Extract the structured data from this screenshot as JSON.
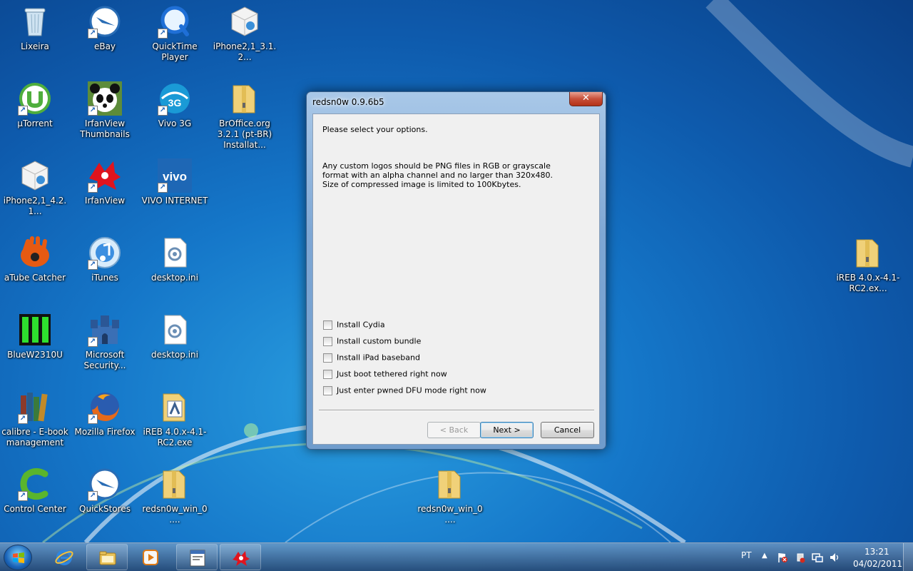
{
  "desktop": {
    "icons": [
      {
        "label": "Lixeira",
        "icon": "recycle-bin-icon",
        "shortcut": false
      },
      {
        "label": "eBay",
        "icon": "quickstores-icon",
        "shortcut": true
      },
      {
        "label": "QuickTime Player",
        "icon": "quicktime-icon",
        "shortcut": true
      },
      {
        "label": "iPhone2,1_3.1.2...",
        "icon": "ipsw-file-icon",
        "shortcut": false
      },
      {
        "label": "µTorrent",
        "icon": "utorrent-icon",
        "shortcut": true
      },
      {
        "label": "IrfanView Thumbnails",
        "icon": "panda-icon",
        "shortcut": true
      },
      {
        "label": "Vivo 3G",
        "icon": "vivo3g-icon",
        "shortcut": true
      },
      {
        "label": "BrOffice.org 3.2.1 (pt-BR) Installat...",
        "icon": "zip-folder-icon",
        "shortcut": false
      },
      {
        "label": "iPhone2,1_4.2.1...",
        "icon": "ipsw-file-icon",
        "shortcut": false
      },
      {
        "label": "IrfanView",
        "icon": "irfanview-icon",
        "shortcut": true
      },
      {
        "label": "VIVO INTERNET",
        "icon": "vivo-internet-icon",
        "shortcut": true
      },
      {
        "label": "aTube Catcher",
        "icon": "atube-catcher-icon",
        "shortcut": false
      },
      {
        "label": "iTunes",
        "icon": "itunes-icon",
        "shortcut": true
      },
      {
        "label": "desktop.ini",
        "icon": "ini-file-icon",
        "shortcut": false
      },
      {
        "label": "BlueW2310U",
        "icon": "signal-bars-icon",
        "shortcut": false
      },
      {
        "label": "Microsoft Security...",
        "icon": "security-castle-icon",
        "shortcut": true
      },
      {
        "label": "desktop.ini",
        "icon": "ini-file-icon",
        "shortcut": false
      },
      {
        "label": "calibre - E-book management",
        "icon": "calibre-books-icon",
        "shortcut": true
      },
      {
        "label": "Mozilla Firefox",
        "icon": "firefox-icon",
        "shortcut": true
      },
      {
        "label": "iREB 4.0.x-4.1-RC2.exe",
        "icon": "ireb-file-icon",
        "shortcut": false
      },
      {
        "label": "Control Center",
        "icon": "control-center-icon",
        "shortcut": true
      },
      {
        "label": "QuickStores",
        "icon": "quickstores-icon",
        "shortcut": true
      },
      {
        "label": "redsn0w_win_0....",
        "icon": "zip-folder-icon",
        "shortcut": false
      },
      {
        "label": "redsn0w_win_0....",
        "icon": "zip-folder-icon",
        "shortcut": false
      },
      {
        "label": "iREB 4.0.x-4.1-RC2.ex...",
        "icon": "zip-folder-icon",
        "shortcut": false
      }
    ]
  },
  "dialog": {
    "title": "redsn0w 0.9.6b5",
    "close_label": "✕",
    "prompt": "Please select your options.",
    "info_lines": [
      "Any custom logos should be PNG files in RGB or grayscale",
      "format with an alpha channel and no larger than 320x480.",
      "Size of compressed image is limited to 100Kbytes."
    ],
    "options": [
      {
        "label": "Install Cydia",
        "checked": false
      },
      {
        "label": "Install custom bundle",
        "checked": false
      },
      {
        "label": "Install iPad baseband",
        "checked": false
      },
      {
        "label": "Just boot tethered right now",
        "checked": false
      },
      {
        "label": "Just enter pwned DFU mode right now",
        "checked": false
      }
    ],
    "buttons": {
      "back": "< Back",
      "next": "Next >",
      "cancel": "Cancel"
    }
  },
  "taskbar": {
    "pinned": [
      "internet-explorer-icon",
      "windows-explorer-icon",
      "media-player-icon",
      "redsn0w-window-icon",
      "irfanview-icon"
    ],
    "language": "PT",
    "time": "13:21",
    "date": "04/02/2011"
  },
  "colors": {
    "accent": "#1577c9",
    "dialog_frame": "#7ea7d4",
    "close_button": "#c7503a"
  }
}
